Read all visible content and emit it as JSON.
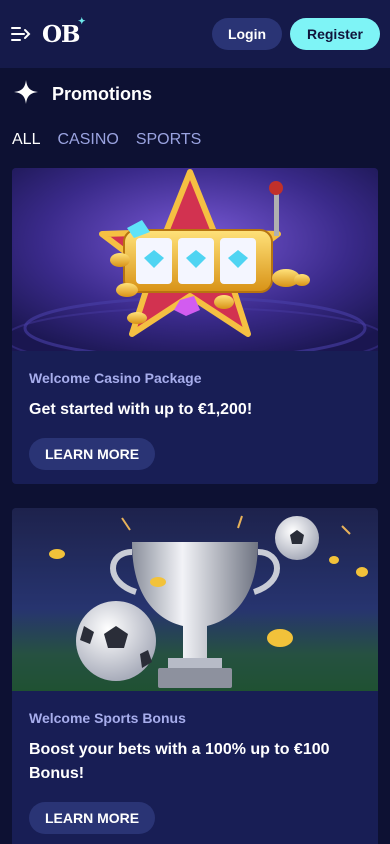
{
  "header": {
    "logo_text": "OB",
    "login_label": "Login",
    "register_label": "Register"
  },
  "page": {
    "title": "Promotions",
    "title_icon": "sparkle-icon"
  },
  "tabs": [
    {
      "label": "ALL",
      "active": true
    },
    {
      "label": "CASINO",
      "active": false
    },
    {
      "label": "SPORTS",
      "active": false
    }
  ],
  "promotions": [
    {
      "eyebrow": "Welcome Casino Package",
      "title": "Get started with up to €1,200!",
      "button": "LEARN MORE",
      "image": "slot-machine-star-illustration"
    },
    {
      "eyebrow": "Welcome Sports Bonus",
      "title": "Boost your bets with a 100% up to €100 Bonus!",
      "button": "LEARN MORE",
      "image": "trophy-footballs-illustration"
    }
  ],
  "colors": {
    "background": "#0d1133",
    "header": "#151a4a",
    "card": "#181e55",
    "accent": "#7ef4f6",
    "button": "#2a3475",
    "muted": "#9aa3e0"
  }
}
